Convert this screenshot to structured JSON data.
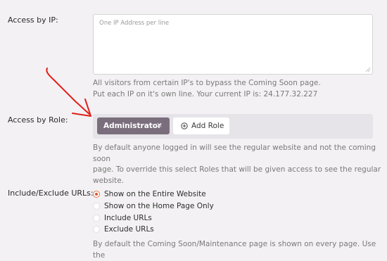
{
  "ip": {
    "label": "Access by IP:",
    "placeholder": "One IP Address per line",
    "help_line1": "All visitors from certain IP's to bypass the Coming Soon page.",
    "help_line2": "Put each IP on it's own line. Your current IP is: 24.177.32.227"
  },
  "role": {
    "label": "Access by Role:",
    "chip_label": "Administrator",
    "chip_remove": "×",
    "add_label": "Add Role",
    "help_line1": "By default anyone logged in will see the regular website and not the coming soon",
    "help_line2": "page. To override this select Roles that will be given access to see the regular",
    "help_line3": "website."
  },
  "urls": {
    "label": "Include/Exclude URLs:",
    "options": [
      {
        "label": "Show on the Entire Website",
        "checked": true
      },
      {
        "label": "Show on the Home Page Only",
        "checked": false
      },
      {
        "label": "Include URLs",
        "checked": false
      },
      {
        "label": "Exclude URLs",
        "checked": false
      }
    ],
    "help_line1": "By default the Coming Soon/Maintenance page is shown on every page. Use the"
  },
  "colors": {
    "accent_radio": "#d9582b",
    "chip_bg": "#7a6e7d",
    "annotation_arrow": "#e0201b"
  }
}
